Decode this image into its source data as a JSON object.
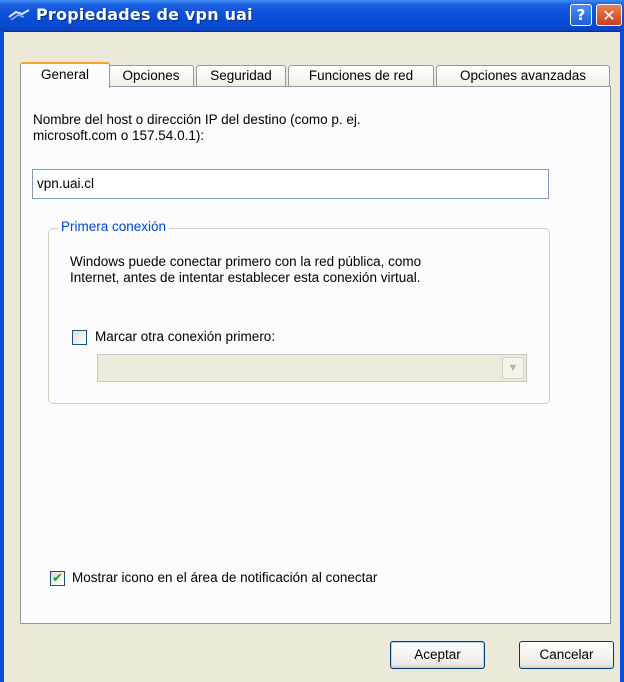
{
  "window": {
    "title": "Propiedades de vpn uai",
    "help_glyph": "?",
    "close_glyph": "✕",
    "icon": "network-connection-icon",
    "colors": {
      "titlebar": "#0a4fd8",
      "dialog": "#ece9d8",
      "group_title": "#0046d5",
      "active_tab_accent": "#f5a623"
    }
  },
  "tabs": [
    {
      "label": "General",
      "active": true
    },
    {
      "label": "Opciones",
      "active": false
    },
    {
      "label": "Seguridad",
      "active": false
    },
    {
      "label": "Funciones de red",
      "active": false
    },
    {
      "label": "Opciones avanzadas",
      "active": false
    }
  ],
  "general": {
    "host_label_line1": "Nombre del host o dirección IP del destino (como p. ej.",
    "host_label_line2": "microsoft.com o 157.54.0.1):",
    "host_value": "vpn.uai.cl",
    "group_title": "Primera conexión",
    "group_text_line1": "Windows puede conectar primero con la red pública, como",
    "group_text_line2": "Internet, antes de intentar establecer esta conexión virtual.",
    "dial_first_label": "Marcar otra conexión primero:",
    "dial_first_checked": false,
    "dial_first_combo_value": "",
    "show_icon_label": "Mostrar icono en el área de notificación al conectar",
    "show_icon_checked": true
  },
  "buttons": {
    "ok": "Aceptar",
    "cancel": "Cancelar"
  }
}
